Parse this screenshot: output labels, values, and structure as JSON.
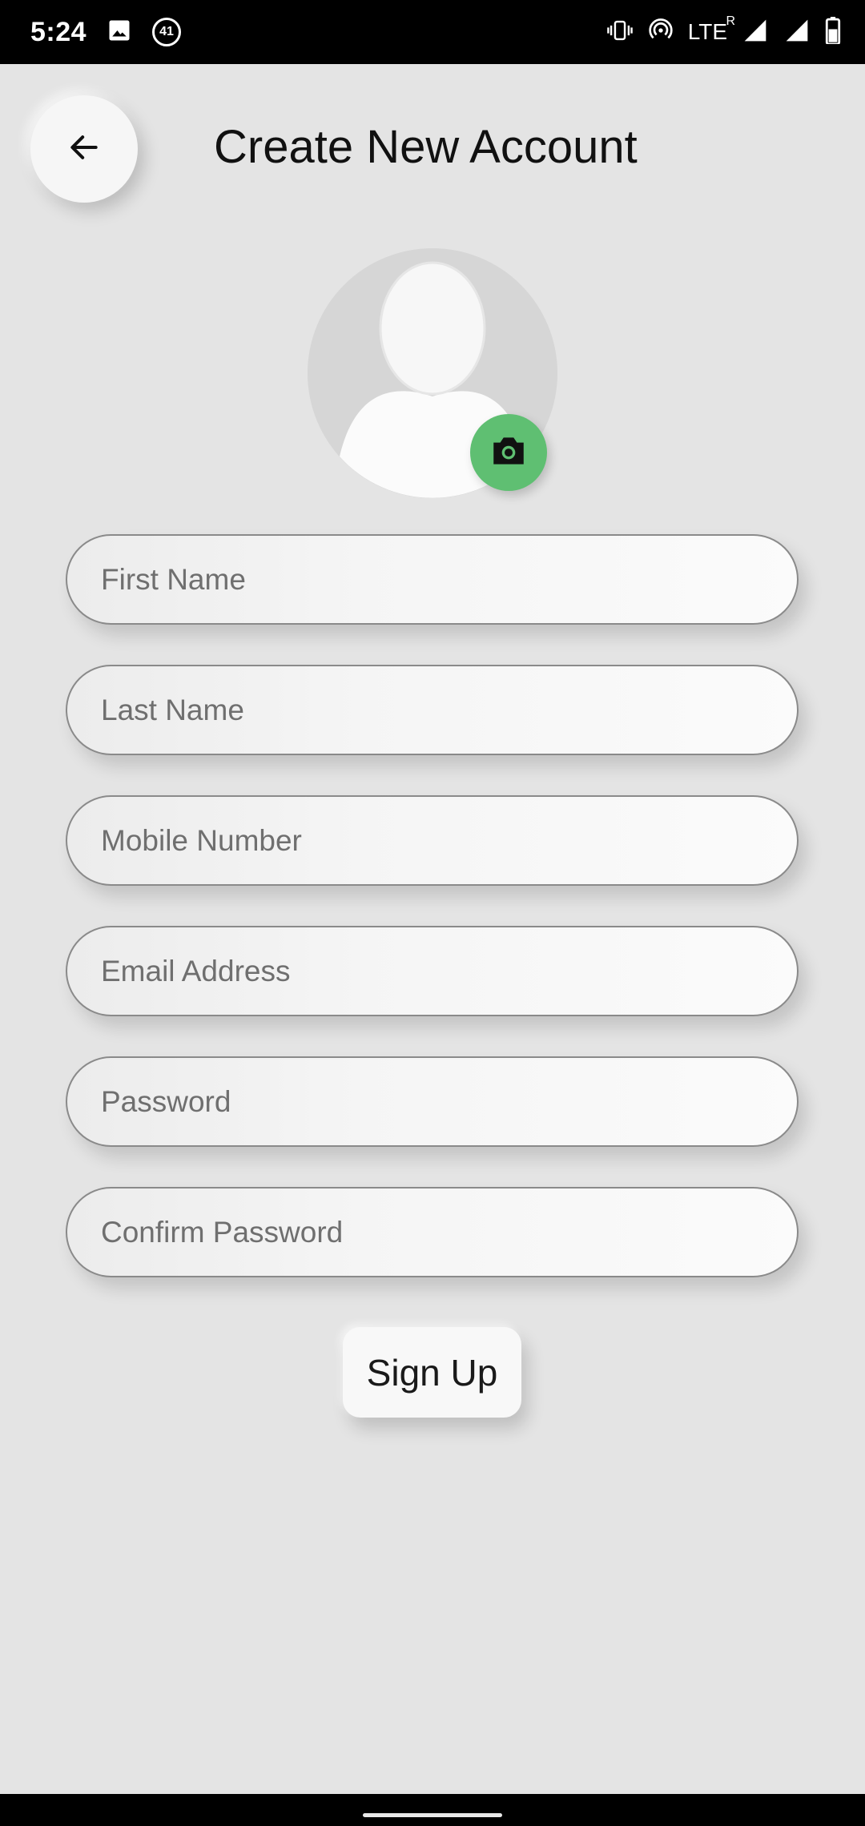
{
  "status_bar": {
    "time": "5:24",
    "notification_count": "41",
    "network": "LTE",
    "roaming": "R",
    "icons": [
      "image-icon",
      "badge-icon",
      "vibrate-icon",
      "hotspot-icon",
      "signal-icon",
      "battery-icon"
    ]
  },
  "header": {
    "back_icon": "arrow-left-icon",
    "title": "Create New Account"
  },
  "avatar": {
    "icon": "person-placeholder-icon",
    "camera_icon": "camera-icon",
    "camera_color": "#5fbf72"
  },
  "form": {
    "fields": [
      {
        "placeholder": "First Name",
        "value": ""
      },
      {
        "placeholder": "Last Name",
        "value": ""
      },
      {
        "placeholder": "Mobile Number",
        "value": ""
      },
      {
        "placeholder": "Email Address",
        "value": ""
      },
      {
        "placeholder": "Password",
        "value": ""
      },
      {
        "placeholder": "Confirm Password",
        "value": ""
      }
    ],
    "submit_label": "Sign Up"
  }
}
